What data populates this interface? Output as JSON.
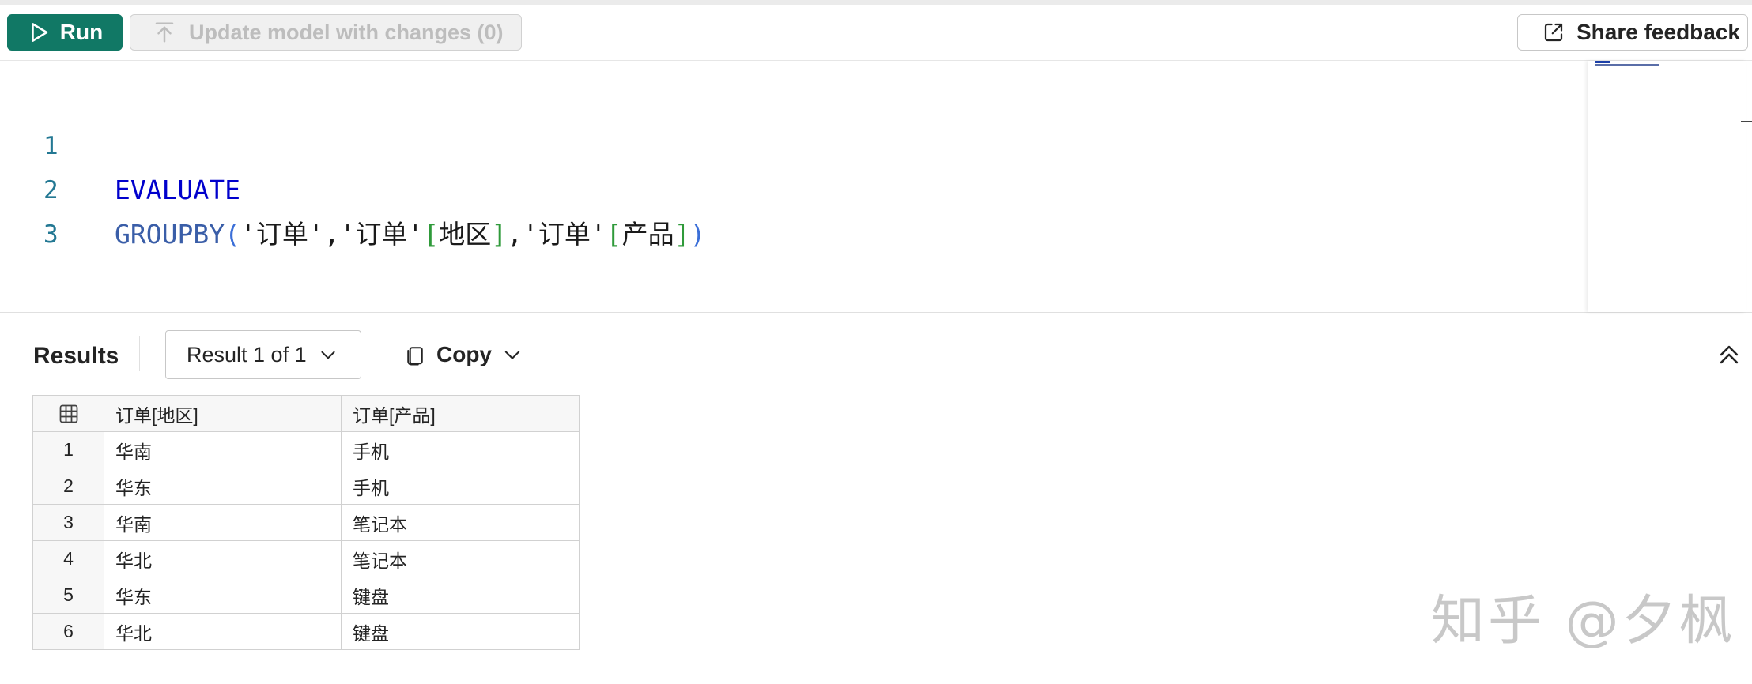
{
  "toolbar": {
    "run_label": "Run",
    "update_label": "Update model with changes (0)",
    "share_label": "Share feedback"
  },
  "editor": {
    "line_numbers": [
      "1",
      "2",
      "3"
    ],
    "line1": {
      "keyword": "EVALUATE"
    },
    "line2": {
      "fn": "GROUPBY",
      "open": "(",
      "s1": "'订单'",
      "comma1": ",",
      "s2": "'订单'",
      "b1o": "[",
      "col1": "地区",
      "b1c": "]",
      "comma2": ",",
      "s3": "'订单'",
      "b2o": "[",
      "col2": "产品",
      "b2c": "]",
      "close": ")"
    }
  },
  "results": {
    "title": "Results",
    "selector": "Result 1 of 1",
    "copy_label": "Copy",
    "columns": [
      "订单[地区]",
      "订单[产品]"
    ],
    "rows": [
      {
        "index": "1",
        "region": "华南",
        "product": "手机"
      },
      {
        "index": "2",
        "region": "华东",
        "product": "手机"
      },
      {
        "index": "3",
        "region": "华南",
        "product": "笔记本"
      },
      {
        "index": "4",
        "region": "华北",
        "product": "笔记本"
      },
      {
        "index": "5",
        "region": "华东",
        "product": "键盘"
      },
      {
        "index": "6",
        "region": "华北",
        "product": "键盘"
      }
    ]
  },
  "watermark": "知乎 @夕枫",
  "colors": {
    "run_button": "#117865",
    "keyword": "#0000cc",
    "line_number": "#237893",
    "bracket": "#2f9a3a"
  },
  "icons": {
    "run": "play-icon",
    "update": "upload-arrow-icon",
    "share": "open-external-icon",
    "copy": "copy-icon",
    "collapse": "chevron-double-up-icon",
    "table_header": "grid-icon"
  }
}
